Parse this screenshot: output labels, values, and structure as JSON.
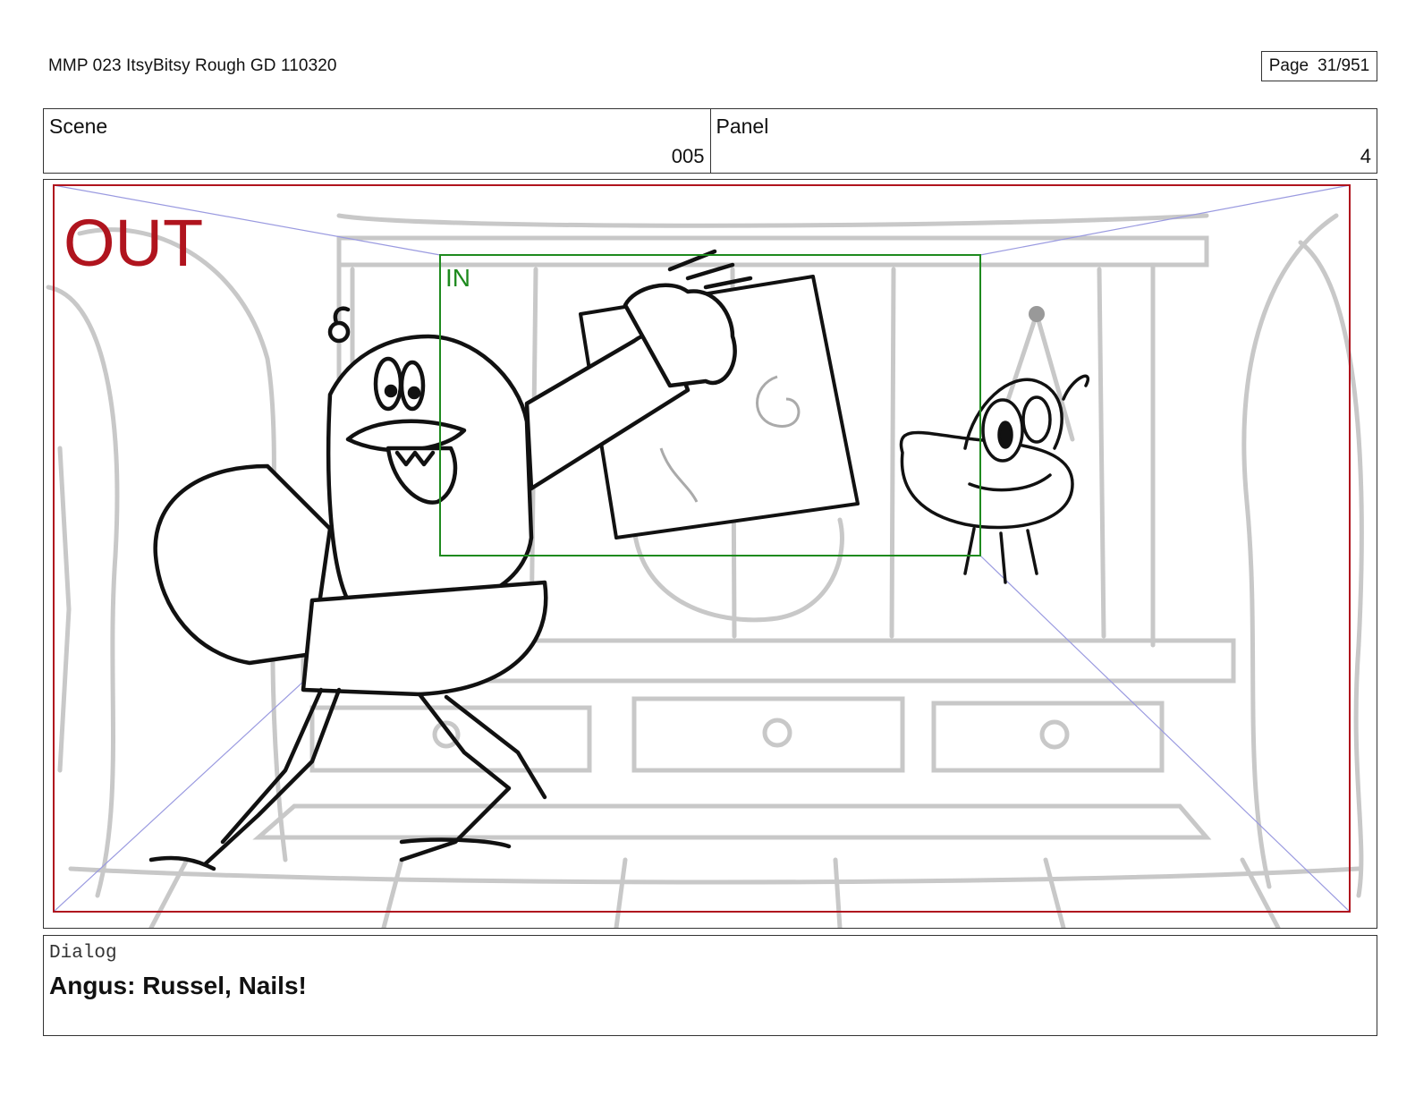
{
  "header": {
    "title": "MMP 023 ItsyBitsy Rough GD 110320",
    "page_label": "Page",
    "page_number": "31/951"
  },
  "meta": {
    "scene_label": "Scene",
    "scene_value": "005",
    "panel_label": "Panel",
    "panel_value": "4"
  },
  "panel": {
    "out_label": "OUT",
    "in_label": "IN",
    "colors": {
      "out_frame": "#b0141e",
      "in_frame": "#1e8a1e",
      "guide_lines": "#9a9ae0",
      "ink": "#111111",
      "background_sketch": "#c8c8c8"
    },
    "illustration": {
      "characters": [
        "large-man-character",
        "small-round-character"
      ],
      "props": [
        "paper-sheet"
      ],
      "setting": "room-interior-sketch"
    }
  },
  "dialog": {
    "label": "Dialog",
    "text": "Angus: Russel, Nails!"
  }
}
